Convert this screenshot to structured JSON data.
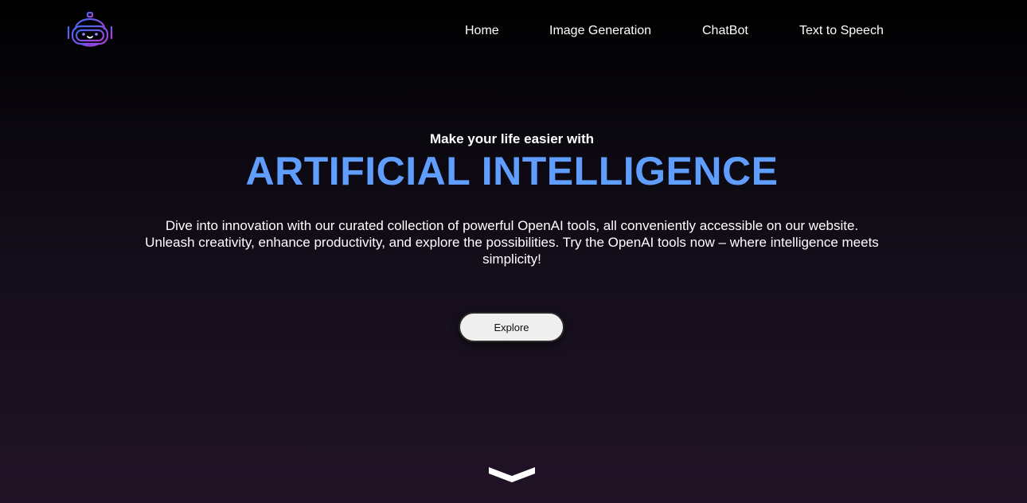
{
  "nav": {
    "items": [
      {
        "label": "Home"
      },
      {
        "label": "Image Generation"
      },
      {
        "label": "ChatBot"
      },
      {
        "label": "Text to Speech"
      }
    ]
  },
  "hero": {
    "subtitle": "Make your life easier with",
    "title": "ARTIFICIAL INTELLIGENCE",
    "description": "Dive into innovation with our curated collection of powerful OpenAI tools, all conveniently accessible on our website. Unleash creativity, enhance productivity, and explore the possibilities. Try the OpenAI tools now – where intelligence meets simplicity!",
    "button_label": "Explore"
  },
  "icons": {
    "logo": "robot-logo-icon",
    "scroll": "chevron-down-icon"
  },
  "colors": {
    "accent": "#5f9eff",
    "logo_gradient_start": "#3b6cf0",
    "logo_gradient_end": "#b43be0"
  }
}
